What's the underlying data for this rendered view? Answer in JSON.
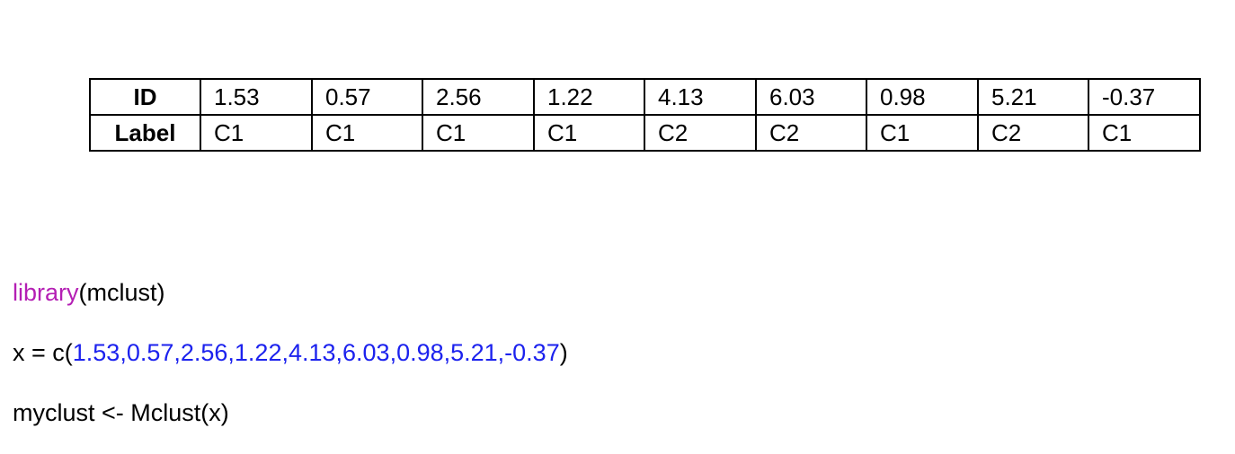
{
  "table": {
    "rows": [
      {
        "header": "ID",
        "cells": [
          "1.53",
          "0.57",
          "2.56",
          "1.22",
          "4.13",
          "6.03",
          "0.98",
          "5.21",
          "-0.37"
        ]
      },
      {
        "header": "Label",
        "cells": [
          "C1",
          "C1",
          "C1",
          "C1",
          "C2",
          "C2",
          "C1",
          "C2",
          "C1"
        ]
      }
    ]
  },
  "code": {
    "line1": {
      "keyword": "library",
      "rest": "(mclust)"
    },
    "line2": {
      "prefix": "x = c(",
      "values": "1.53,0.57,2.56,1.22,4.13,6.03,0.98,5.21,-0.37",
      "suffix": ")"
    },
    "line3": {
      "text": "myclust <- Mclust(x)"
    }
  },
  "colors": {
    "keyword": "#b41fb4",
    "numbers": "#1c22ee",
    "text": "#000000",
    "border": "#000000"
  }
}
